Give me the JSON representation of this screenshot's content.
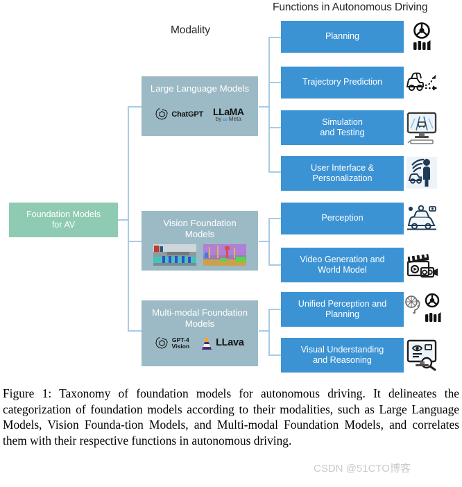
{
  "figure": {
    "headings": {
      "functions": "Functions in Autonomous Driving",
      "modality": "Modality"
    },
    "root": {
      "line1": "Foundation Models",
      "line2": "for AV",
      "color": "#8ECBB2"
    },
    "modality_color": "#9CBAC5",
    "function_color": "#3C93D4",
    "connector_color": "#A8CBE4",
    "modalities": [
      {
        "name": "large-language-models",
        "line1": "Large Language Models",
        "line2": "",
        "logos": [
          {
            "name": "openai-chatgpt-logo",
            "label": "ChatGPT"
          },
          {
            "name": "meta-llama-logo",
            "label": "LLaMA",
            "sublabel": "by",
            "sub2": "Meta"
          }
        ]
      },
      {
        "name": "vision-foundation-models",
        "line1": "Vision Foundation",
        "line2": "Models",
        "thumbnails": [
          {
            "name": "street-segmentation-thumbnail-1"
          },
          {
            "name": "street-segmentation-thumbnail-2"
          }
        ]
      },
      {
        "name": "multi-modal-foundation-models",
        "line1": "Multi-modal Foundation",
        "line2": "Models",
        "logos": [
          {
            "name": "openai-gpt4-vision-logo",
            "label": "GPT-4",
            "sublabel": "Vision"
          },
          {
            "name": "llava-logo",
            "label": "LLava"
          }
        ]
      }
    ],
    "functions": [
      {
        "name": "planning",
        "line1": "Planning",
        "line2": "",
        "icon": "steering-wheel-pedals-icon"
      },
      {
        "name": "trajectory-prediction",
        "line1": "Trajectory Prediction",
        "line2": "",
        "icon": "car-trajectory-icon"
      },
      {
        "name": "simulation-and-testing",
        "line1": "Simulation",
        "line2": "and Testing",
        "icon": "simulation-monitor-icon"
      },
      {
        "name": "user-interface-personalization",
        "line1": "User Interface &",
        "line2": "Personalization",
        "icon": "user-vehicle-connectivity-icon"
      },
      {
        "name": "perception",
        "line1": "Perception",
        "line2": "",
        "icon": "sensor-car-perception-icon"
      },
      {
        "name": "video-generation-world-model",
        "line1": "Video Generation and",
        "line2": "World Model",
        "icon": "film-clapper-camera-icon"
      },
      {
        "name": "unified-perception-planning",
        "line1": "Unified Perception and",
        "line2": "Planning",
        "icon": "brain-steering-wheel-icon"
      },
      {
        "name": "visual-understanding-reasoning",
        "line1": "Visual Understanding",
        "line2": "and Reasoning",
        "icon": "monitor-eye-magnifier-icon"
      }
    ]
  },
  "caption": {
    "text": "Figure 1: Taxonomy of foundation models for autonomous driving. It delineates the categorization of foundation models according to their modalities, such as Large Language Models, Vision Founda-tion Models, and Multi-modal Foundation Models, and correlates them with their respective functions in autonomous driving."
  },
  "watermark": {
    "text": "CSDN @51CTO博客"
  }
}
